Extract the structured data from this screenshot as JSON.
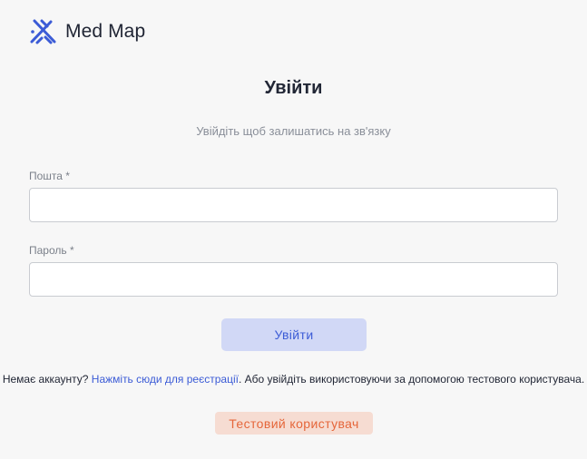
{
  "brand": {
    "name": "Med Map",
    "logo_icon": "medmap-logo-icon",
    "accent_color": "#3b5bd6"
  },
  "login": {
    "title": "Увійти",
    "subtitle": "Увійдіть щоб залишатись на зв'язку",
    "email_label": "Пошта *",
    "email_value": "",
    "password_label": "Пароль *",
    "password_value": "",
    "submit_label": "Увійти"
  },
  "signup": {
    "prefix": "Немає аккаунту? ",
    "link_text": "Нажміть сюди для реєстрації",
    "suffix": ". Або увійдіть використовуючи за допомогою тестового користувача."
  },
  "test_user": {
    "label": "Тестовий користувач",
    "color": "#e5663a",
    "background": "#f6dcd2"
  }
}
